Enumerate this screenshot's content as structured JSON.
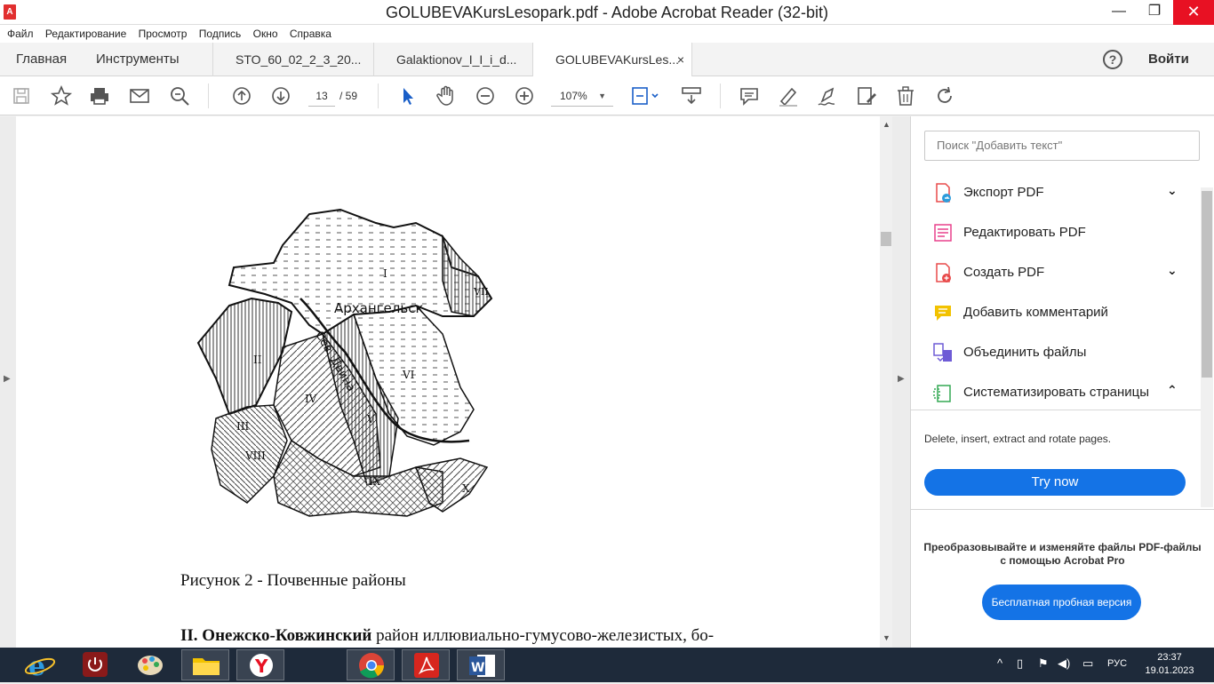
{
  "window": {
    "title": "GOLUBEVAKursLesopark.pdf - Adobe Acrobat Reader (32-bit)",
    "minimize": "—",
    "maximize": "❐",
    "close": "✕"
  },
  "menu": [
    "Файл",
    "Редактирование",
    "Просмотр",
    "Подпись",
    "Окно",
    "Справка"
  ],
  "tabs": {
    "home": "Главная",
    "tools": "Инструменты",
    "documents": [
      {
        "label": "STO_60_02_2_3_20...",
        "active": false
      },
      {
        "label": "Galaktionov_I_I_i_d...",
        "active": false
      },
      {
        "label": "GOLUBEVAKursLes...",
        "active": true
      }
    ],
    "close_glyph": "×",
    "help": "?",
    "signin": "Войти"
  },
  "toolbar": {
    "page_current": "13",
    "page_total": "/ 59",
    "zoom": "107%",
    "zoom_caret": "▼"
  },
  "document": {
    "map_labels": [
      "Архангельск",
      "Сев. Двина",
      "I",
      "II",
      "III",
      "IV",
      "V",
      "VI",
      "VII",
      "VIII",
      "IX",
      "X"
    ],
    "caption": "Рисунок  2 -  Почвенные районы",
    "body_bold": "II. Онежско-Ковжинский",
    "body_rest": " район  иллювиально-гумусово-железистых,  бо-"
  },
  "right_panel": {
    "search_placeholder": "Поиск \"Добавить текст\"",
    "tools": [
      {
        "label": "Экспорт PDF",
        "icon": "export-pdf-icon",
        "color": "#2d9cdb",
        "chevron": "⌄"
      },
      {
        "label": "Редактировать PDF",
        "icon": "edit-pdf-icon",
        "color": "#e8418c",
        "chevron": ""
      },
      {
        "label": "Создать PDF",
        "icon": "create-pdf-icon",
        "color": "#e84a4a",
        "chevron": "⌄"
      },
      {
        "label": "Добавить комментарий",
        "icon": "comment-icon",
        "color": "#f2c200",
        "chevron": ""
      },
      {
        "label": "Объединить файлы",
        "icon": "combine-files-icon",
        "color": "#6e5bd6",
        "chevron": ""
      },
      {
        "label": "Систематизировать страницы",
        "icon": "organize-pages-icon",
        "color": "#34a853",
        "chevron": "⌃"
      }
    ],
    "description": "Delete, insert, extract and rotate pages.",
    "try_now": "Try now",
    "promo_line1": "Преобразовывайте и изменяйте файлы PDF-файлы",
    "promo_line2": "с помощью Acrobat Pro",
    "trial_button": "Бесплатная пробная версия"
  },
  "taskbar": {
    "apps": [
      "internet-explorer",
      "power",
      "paint",
      "file-explorer",
      "yandex-browser",
      "chrome",
      "acrobat-reader",
      "word"
    ],
    "language": "РУС",
    "time": "23:37",
    "date": "19.01.2023"
  },
  "colors": {
    "accent": "#1473e6",
    "close_red": "#e81123",
    "taskbar": "#1e2a3a"
  }
}
